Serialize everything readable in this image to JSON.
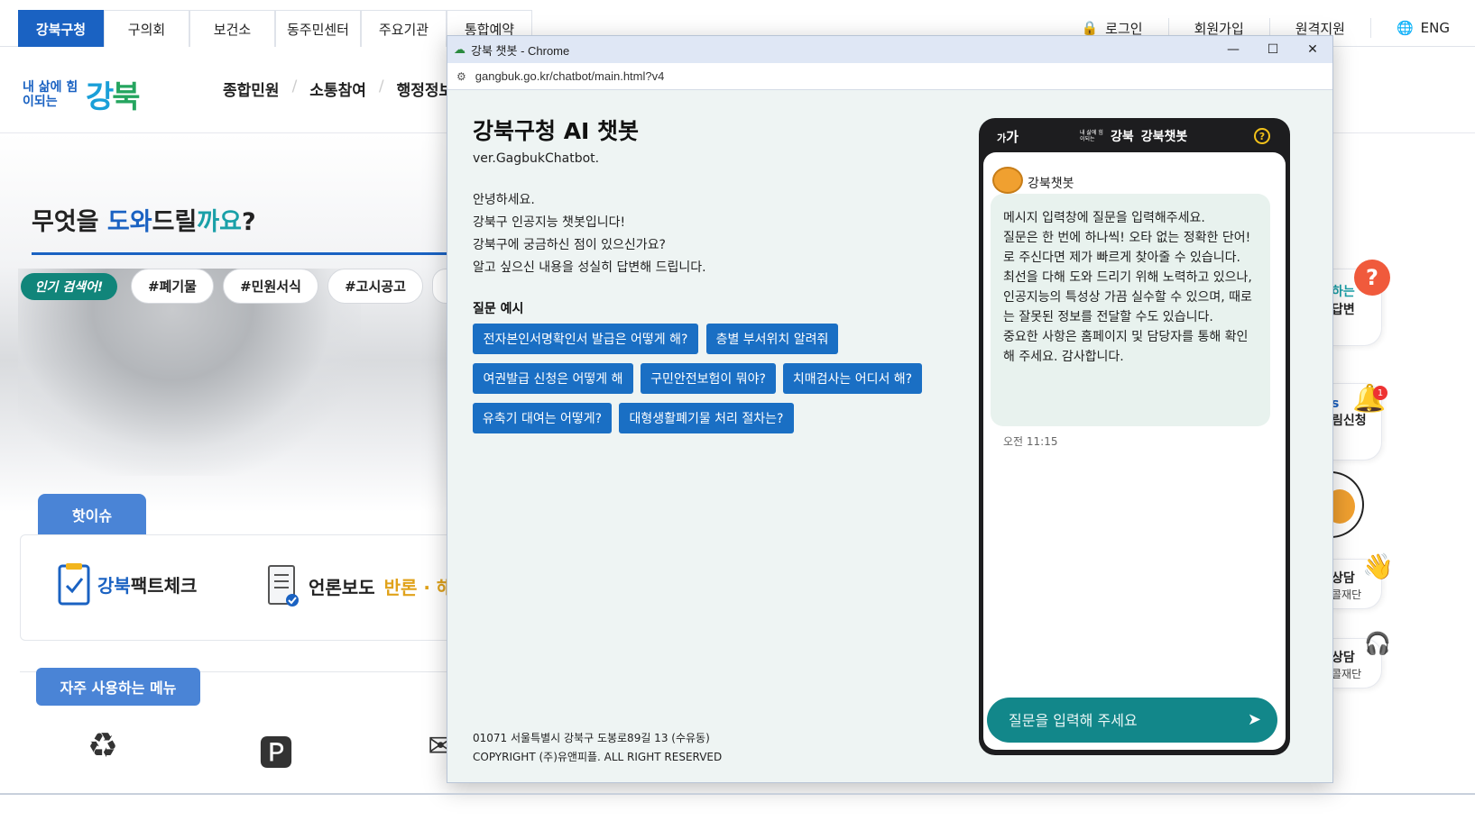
{
  "site": {
    "top_tabs": [
      {
        "label": "강북구청",
        "active": true
      },
      {
        "label": "구의회",
        "active": false
      },
      {
        "label": "보건소",
        "active": false
      },
      {
        "label": "동주민센터",
        "active": false
      },
      {
        "label": "주요기관",
        "active": false
      },
      {
        "label": "통합예약",
        "active": false
      }
    ],
    "util": {
      "login": "로그인",
      "signup": "회원가입",
      "remote": "원격지원",
      "lang": "ENG"
    },
    "logo": {
      "small": "내 삶에 힘이되는",
      "big_a": "강",
      "big_b": "북"
    },
    "gnb": [
      "종합민원",
      "소통참여",
      "행정정보"
    ],
    "hero": {
      "title_1": "무엇을 ",
      "title_blue": "도와",
      "title_2": "드릴",
      "title_teal": "까요",
      "title_3": "?"
    },
    "popular_badge": "인기 검색어!",
    "tags": [
      "#폐기물",
      "#민원서식",
      "#고시공고"
    ],
    "hot_issue_tab": "핫이슈",
    "fact_check": {
      "a": "강북",
      "b": "팩트체크"
    },
    "press": {
      "a": "언론보도 ",
      "b": "반론 · 해명"
    },
    "freq_menu_tab": "자주 사용하는 메뉴",
    "side": {
      "card1_line1": "하는",
      "card1_line2": "답변",
      "card2_line1": "s",
      "card2_line2": "림신청",
      "bell_count": "1",
      "card4_line1": "상담",
      "card4_line2": "콜재단",
      "card5_line1": "상담",
      "card5_line2": "콜재단"
    }
  },
  "window": {
    "title": "강북 챗봇 - Chrome",
    "url": "gangbuk.go.kr/chatbot/main.html?v4",
    "controls": {
      "minimize": "—",
      "maximize": "☐",
      "close": "✕"
    }
  },
  "chat": {
    "title": "강북구청 AI 챗봇",
    "version": "ver.GagbukChatbot.",
    "intro": [
      "안녕하세요.",
      "강북구 인공지능 챗봇입니다!",
      "강북구에 궁금하신 점이 있으신가요?",
      "알고 싶으신 내용을 성실히 답변해 드립니다."
    ],
    "examples_label": "질문 예시",
    "examples": [
      "전자본인서명확인서 발급은 어떻게 해?",
      "층별 부서위치 알려줘",
      "여권발급 신청은 어떻게 해",
      "구민안전보험이 뭐야?",
      "치매검사는 어디서 해?",
      "유축기 대여는 어떻게?",
      "대형생활폐기물 처리 절차는?"
    ],
    "footer_address": "01071 서울특별시 강북구 도봉로89길 13 (수유동)",
    "footer_copyright": "COPYRIGHT (주)유앤피플. ALL RIGHT RESERVED"
  },
  "phone": {
    "font_toggle_small": "가",
    "font_toggle_big": "가",
    "brand_small": "내 삶에 힘이되는",
    "brand_logo": "강북",
    "brand_name": "강북챗봇",
    "help": "?",
    "bot_name": "강북챗봇",
    "message": [
      "메시지 입력창에 질문을 입력해주세요.",
      "질문은 한 번에 하나씩! 오타 없는 정확한 단어! 로 주신다면 제가 빠르게 찾아줄 수 있습니다.",
      "최선을 다해 도와 드리기 위해 노력하고 있으나, 인공지능의 특성상 가끔 실수할 수 있으며, 때로는 잘못된 정보를 전달할 수도 있습니다.",
      "중요한 사항은 홈페이지 및 담당자를 통해 확인해 주세요. 감사합니다."
    ],
    "time": "오전 11:15",
    "input_placeholder": "질문을 입력해 주세요"
  },
  "colors": {
    "brand_blue": "#1a62c2",
    "chip_blue": "#1a6fc4",
    "teal": "#12878a"
  }
}
